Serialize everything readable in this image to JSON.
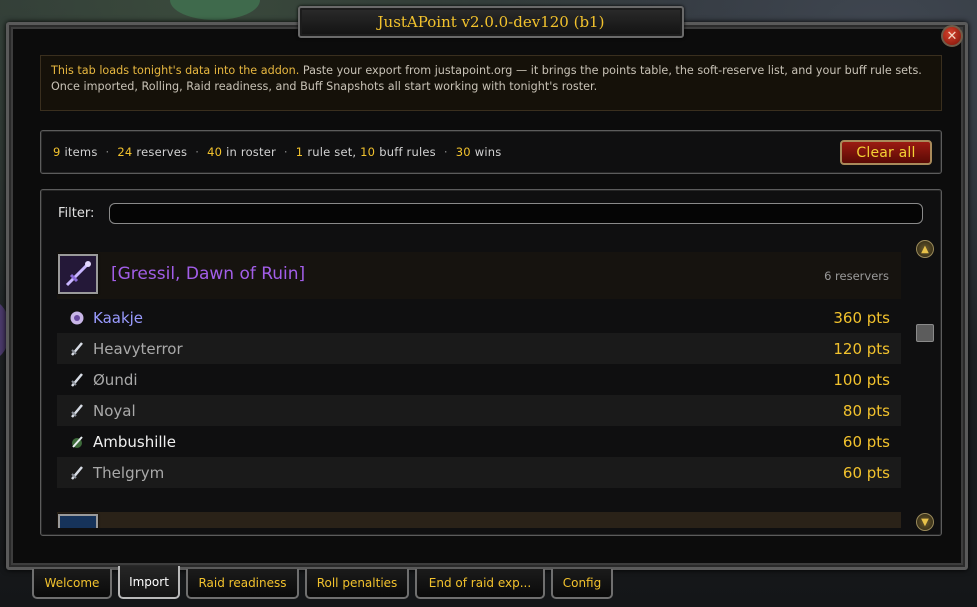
{
  "window": {
    "title": "JustAPoint  v2.0.0-dev120 (b1)",
    "close_glyph": "✕"
  },
  "info": {
    "lead": "This tab loads tonight's data into the addon.",
    "rest": "  Paste your export from justapoint.org — it brings the points table, the soft-reserve list, and your buff rule sets. Once imported, Rolling, Raid readiness, and Buff Snapshots all start working with tonight's roster."
  },
  "stats": {
    "items_num": "9",
    "items_label": "items",
    "reserves_num": "24",
    "reserves_label": "reserves",
    "roster_num": "40",
    "roster_label": "in roster",
    "rulesets_num": "1",
    "rulesets_label": "rule set,",
    "buffrules_num": "10",
    "buffrules_label": "buff rules",
    "wins_num": "30",
    "wins_label": "wins",
    "separator": "·",
    "clear_label": "Clear all"
  },
  "filter": {
    "label": "Filter:",
    "value": ""
  },
  "item": {
    "name": "[Gressil, Dawn of Ruin]",
    "reservers": "6 reservers",
    "icon": "sword-item-icon",
    "rows": [
      {
        "name": "Kaakje",
        "pts": "360 pts",
        "class_icon": "priest-class-icon",
        "color": "#9a9bff"
      },
      {
        "name": "Heavyterror",
        "pts": "120 pts",
        "class_icon": "warrior-class-icon",
        "color": "#a9a9a9"
      },
      {
        "name": "Øundi",
        "pts": "100 pts",
        "class_icon": "warrior-class-icon",
        "color": "#a9a9a9"
      },
      {
        "name": "Noyal",
        "pts": "80 pts",
        "class_icon": "warrior-class-icon",
        "color": "#a9a9a9"
      },
      {
        "name": "Ambushille",
        "pts": "60 pts",
        "class_icon": "rogue-class-icon",
        "color": "#f0f0f0"
      },
      {
        "name": "Thelgrym",
        "pts": "60 pts",
        "class_icon": "warrior-class-icon",
        "color": "#a9a9a9"
      }
    ]
  },
  "tabs": [
    {
      "label": "Welcome"
    },
    {
      "label": "Import"
    },
    {
      "label": "Raid readiness"
    },
    {
      "label": "Roll penalties"
    },
    {
      "label": "End of raid exp..."
    },
    {
      "label": "Config"
    }
  ],
  "colors": {
    "accent_gold": "#f2c22d",
    "epic_purple": "#a25ee8",
    "priest": "#9a9bff"
  }
}
